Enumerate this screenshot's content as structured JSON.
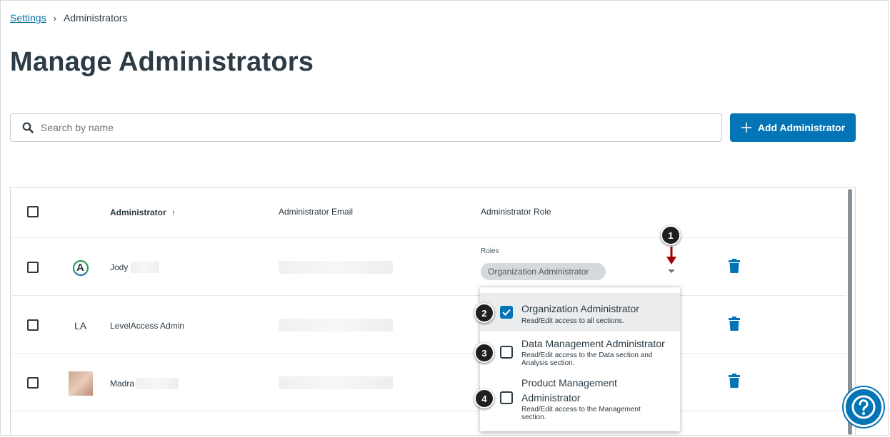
{
  "breadcrumb": {
    "parent": "Settings",
    "separator": "›",
    "current": "Administrators"
  },
  "page": {
    "title": "Manage Administrators"
  },
  "search": {
    "placeholder": "Search by name"
  },
  "actions": {
    "add_label": "Add Administrator"
  },
  "table": {
    "headers": {
      "administrator": "Administrator",
      "sort_indicator": "↑",
      "email": "Administrator Email",
      "role": "Administrator Role"
    },
    "rows": [
      {
        "avatar_text": "A",
        "name": "Jody"
      },
      {
        "avatar_text": "LA",
        "name": "LevelAccess Admin"
      },
      {
        "avatar_text": "",
        "name": "Madra"
      }
    ]
  },
  "role_select": {
    "label": "Roles",
    "selected_pill": "Organization Administrator",
    "options": [
      {
        "title": "Organization Administrator",
        "description": "Read/Edit access to all sections.",
        "checked": true
      },
      {
        "title": "Data Management Administrator",
        "description": "Read/Edit access to the Data section and Analysis section.",
        "checked": false
      },
      {
        "title": "Product Management Administrator",
        "description": "Read/Edit access to the Management section.",
        "checked": false
      }
    ]
  },
  "callouts": [
    "1",
    "2",
    "3",
    "4"
  ],
  "colors": {
    "primary": "#0374b5",
    "text": "#2d3b45",
    "callout_arrow": "#a30000"
  },
  "icons": {
    "search": "search-icon",
    "add": "plus-icon",
    "delete": "trash-icon",
    "help": "help-icon",
    "checkmark": "checkmark-icon",
    "sort": "arrow-up-icon",
    "caret": "caret-down-icon"
  }
}
